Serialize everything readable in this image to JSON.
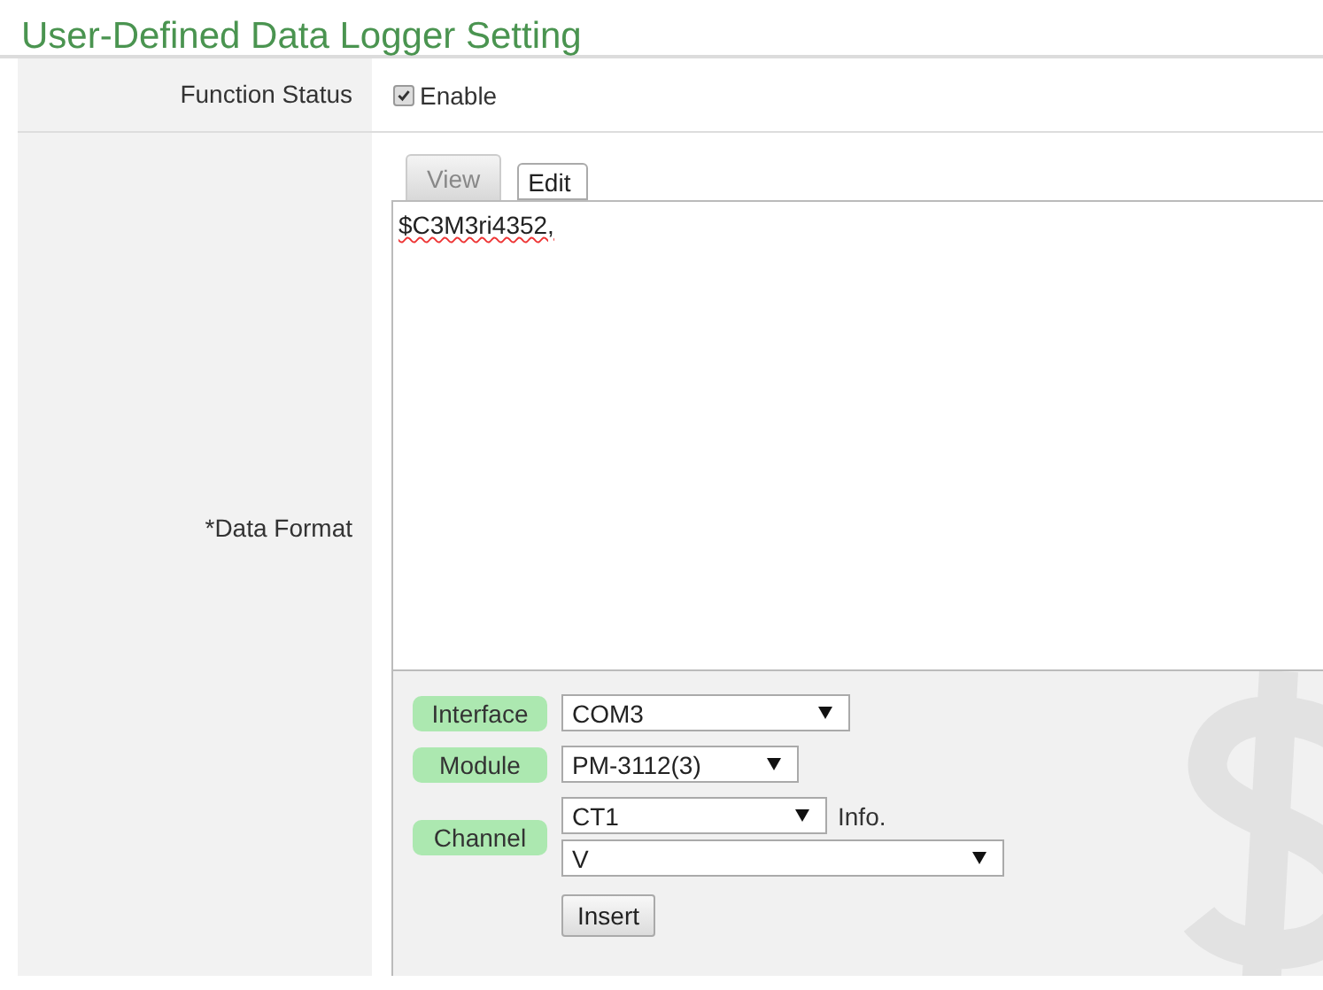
{
  "title": "User-Defined Data Logger Setting",
  "function_status": {
    "label": "Function Status",
    "checkbox": {
      "label": "Enable",
      "checked": true
    }
  },
  "data_format": {
    "label": "*Data Format",
    "tabs": [
      {
        "label": "View",
        "selected": false
      },
      {
        "label": "Edit",
        "selected": true
      }
    ],
    "editor_value": "$C3M3ri4352,",
    "fields": [
      {
        "label": "Interface",
        "selects": [
          {
            "value": "COM3"
          }
        ]
      },
      {
        "label": "Module",
        "selects": [
          {
            "value": "PM-3112(3)"
          }
        ]
      },
      {
        "label": "Channel",
        "selects": [
          {
            "value": "CT1"
          },
          {
            "value": "V"
          }
        ],
        "note": "Info."
      }
    ],
    "insert_button": "Insert"
  }
}
